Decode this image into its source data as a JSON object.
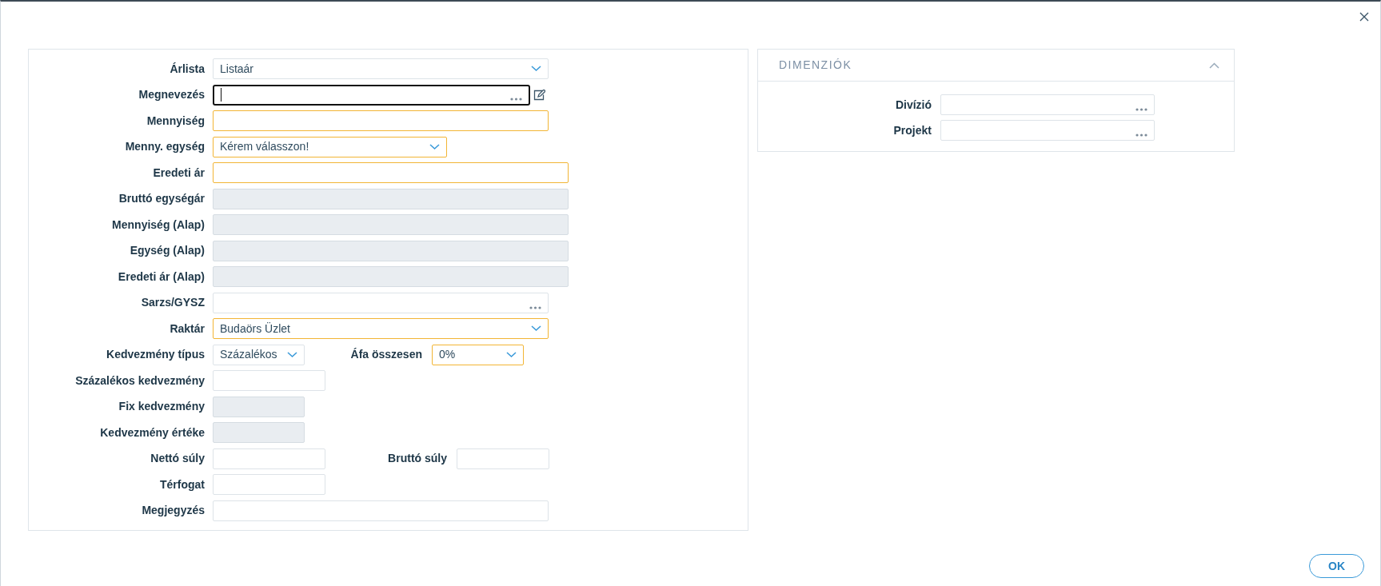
{
  "form": {
    "rows": [
      {
        "label": "Árlista",
        "field": {
          "kind": "select",
          "value": "Listaár",
          "required": false,
          "focused": false,
          "edit_button": false
        }
      },
      {
        "label": "Megnevezés",
        "field": {
          "kind": "lookup",
          "required": false,
          "focused": true,
          "edit_button": true
        }
      },
      {
        "label": "Mennyiség",
        "field": {
          "kind": "text",
          "required": true,
          "focused": false,
          "edit_button": false
        }
      },
      {
        "label": "Menny. egység",
        "field": {
          "kind": "select",
          "value": "Kérem válasszon!",
          "required": true,
          "focused": false,
          "edit_button": false
        }
      },
      {
        "label": "Eredeti ár",
        "field": {
          "kind": "text",
          "required": true,
          "focused": false,
          "edit_button": false
        }
      },
      {
        "label": "Bruttó egységár",
        "field": {
          "kind": "readonly",
          "required": false,
          "focused": false,
          "edit_button": false
        }
      },
      {
        "label": "Mennyiség (Alap)",
        "field": {
          "kind": "readonly",
          "required": false,
          "focused": false,
          "edit_button": false
        }
      },
      {
        "label": "Egység (Alap)",
        "field": {
          "kind": "readonly",
          "required": false,
          "focused": false,
          "edit_button": false
        }
      },
      {
        "label": "Eredeti ár (Alap)",
        "field": {
          "kind": "readonly",
          "required": false,
          "focused": false,
          "edit_button": false
        }
      },
      {
        "label": "Sarzs/GYSZ",
        "field": {
          "kind": "lookup",
          "required": false,
          "focused": false,
          "edit_button": false
        }
      },
      {
        "label": "Raktár",
        "field": {
          "kind": "select",
          "value": "Budaörs Üzlet",
          "required": true,
          "focused": false,
          "edit_button": false
        }
      },
      {
        "label": "Kedvezmény típus",
        "field": {
          "kind": "select",
          "value": "Százalékos",
          "required": false,
          "focused": false,
          "edit_button": false
        },
        "side": {
          "label": "Áfa összesen",
          "field": {
            "kind": "select",
            "value": "0%",
            "required": true,
            "focused": false,
            "edit_button": false
          }
        }
      },
      {
        "label": "Százalékos kedvezmény",
        "field": {
          "kind": "text",
          "required": false,
          "focused": false,
          "edit_button": false
        }
      },
      {
        "label": "Fix kedvezmény",
        "field": {
          "kind": "readonly",
          "required": false,
          "focused": false,
          "edit_button": false
        }
      },
      {
        "label": "Kedvezmény értéke",
        "field": {
          "kind": "readonly",
          "required": false,
          "focused": false,
          "edit_button": false
        }
      },
      {
        "label": "Nettó súly",
        "field": {
          "kind": "text",
          "required": false,
          "focused": false,
          "edit_button": false
        },
        "side": {
          "label": "Bruttó súly",
          "field": {
            "kind": "text",
            "required": false,
            "focused": false,
            "edit_button": false
          }
        }
      },
      {
        "label": "Térfogat",
        "field": {
          "kind": "text",
          "required": false,
          "focused": false,
          "edit_button": false
        }
      },
      {
        "label": "Megjegyzés",
        "field": {
          "kind": "text",
          "required": false,
          "focused": false,
          "edit_button": false
        }
      }
    ]
  },
  "dimensions": {
    "title": "DIMENZIÓK",
    "expanded": true,
    "rows": [
      {
        "label": "Divízió",
        "field": {
          "kind": "lookup",
          "required": false,
          "focused": false,
          "edit_button": false
        }
      },
      {
        "label": "Projekt",
        "field": {
          "kind": "lookup",
          "required": false,
          "focused": false,
          "edit_button": false
        }
      }
    ]
  },
  "ok_button": "OK"
}
